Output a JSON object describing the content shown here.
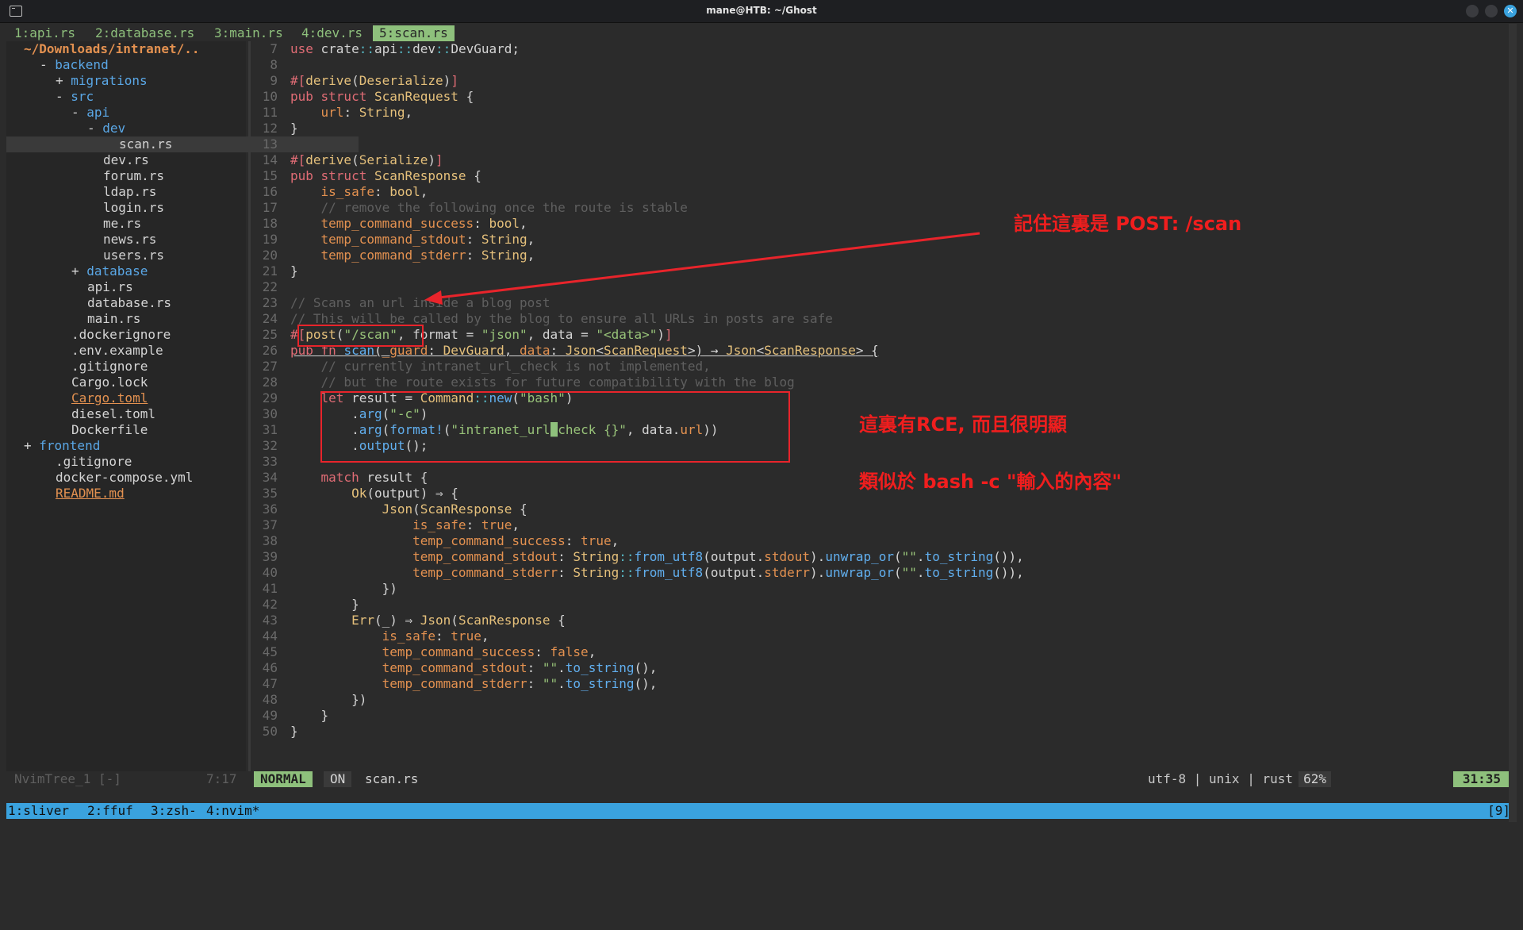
{
  "window": {
    "title": "mane@HTB: ~/Ghost"
  },
  "tabs": [
    "1:api.rs",
    "2:database.rs",
    "3:main.rs",
    "4:dev.rs",
    "5:scan.rs"
  ],
  "tree": {
    "root": "~/Downloads/intranet/..",
    "items": [
      {
        "sign": "- ",
        "name": "backend",
        "indent": 1,
        "kind": "dir"
      },
      {
        "sign": "+ ",
        "name": "migrations",
        "indent": 2,
        "kind": "dir"
      },
      {
        "sign": "- ",
        "name": "src",
        "indent": 2,
        "kind": "dir"
      },
      {
        "sign": "- ",
        "name": "api",
        "indent": 3,
        "kind": "dir"
      },
      {
        "sign": "- ",
        "name": "dev",
        "indent": 4,
        "kind": "dir"
      },
      {
        "sign": "",
        "name": "scan.rs",
        "indent": 6,
        "kind": "file",
        "selected": true
      },
      {
        "sign": "",
        "name": "dev.rs",
        "indent": 5,
        "kind": "file"
      },
      {
        "sign": "",
        "name": "forum.rs",
        "indent": 5,
        "kind": "file"
      },
      {
        "sign": "",
        "name": "ldap.rs",
        "indent": 5,
        "kind": "file"
      },
      {
        "sign": "",
        "name": "login.rs",
        "indent": 5,
        "kind": "file"
      },
      {
        "sign": "",
        "name": "me.rs",
        "indent": 5,
        "kind": "file"
      },
      {
        "sign": "",
        "name": "news.rs",
        "indent": 5,
        "kind": "file"
      },
      {
        "sign": "",
        "name": "users.rs",
        "indent": 5,
        "kind": "file"
      },
      {
        "sign": "+ ",
        "name": "database",
        "indent": 3,
        "kind": "dir"
      },
      {
        "sign": "",
        "name": "api.rs",
        "indent": 4,
        "kind": "file"
      },
      {
        "sign": "",
        "name": "database.rs",
        "indent": 4,
        "kind": "file"
      },
      {
        "sign": "",
        "name": "main.rs",
        "indent": 4,
        "kind": "file"
      },
      {
        "sign": "",
        "name": ".dockerignore",
        "indent": 3,
        "kind": "file"
      },
      {
        "sign": "",
        "name": ".env.example",
        "indent": 3,
        "kind": "file"
      },
      {
        "sign": "",
        "name": ".gitignore",
        "indent": 3,
        "kind": "file"
      },
      {
        "sign": "",
        "name": "Cargo.lock",
        "indent": 3,
        "kind": "file"
      },
      {
        "sign": "",
        "name": "Cargo.toml",
        "indent": 3,
        "kind": "special"
      },
      {
        "sign": "",
        "name": "diesel.toml",
        "indent": 3,
        "kind": "file"
      },
      {
        "sign": "",
        "name": "Dockerfile",
        "indent": 3,
        "kind": "file"
      },
      {
        "sign": "+ ",
        "name": "frontend",
        "indent": 0,
        "kind": "dir"
      },
      {
        "sign": "",
        "name": ".gitignore",
        "indent": 2,
        "kind": "file"
      },
      {
        "sign": "",
        "name": "docker-compose.yml",
        "indent": 2,
        "kind": "file"
      },
      {
        "sign": "",
        "name": "README.md",
        "indent": 2,
        "kind": "special"
      }
    ]
  },
  "editor": {
    "lines": [
      {
        "n": 7,
        "html": "<span class=\"kw\">use</span> crate<span class=\"mc\">::</span>api<span class=\"mc\">::</span>dev<span class=\"mc\">::</span>DevGuard;"
      },
      {
        "n": 8,
        "html": ""
      },
      {
        "n": 9,
        "html": "<span class=\"kw\">#[</span><span class=\"ty\">derive</span>(<span class=\"ty\">Deserialize</span>)<span class=\"kw\">]</span>"
      },
      {
        "n": 10,
        "html": "<span class=\"kw\">pub struct</span> <span class=\"ty\">ScanRequest</span> {"
      },
      {
        "n": 11,
        "html": "    <span class=\"fd\">url</span>: <span class=\"ty\">String</span>,"
      },
      {
        "n": 12,
        "html": "}"
      },
      {
        "n": 13,
        "html": ""
      },
      {
        "n": 14,
        "html": "<span class=\"kw\">#[</span><span class=\"ty\">derive</span>(<span class=\"ty\">Serialize</span>)<span class=\"kw\">]</span>"
      },
      {
        "n": 15,
        "html": "<span class=\"kw\">pub struct</span> <span class=\"ty\">ScanResponse</span> {"
      },
      {
        "n": 16,
        "html": "    <span class=\"fd\">is_safe</span>: <span class=\"ty\">bool</span>,"
      },
      {
        "n": 17,
        "html": "    <span class=\"cm\">// remove the following once the route is stable</span>"
      },
      {
        "n": 18,
        "html": "    <span class=\"fd\">temp_command_success</span>: <span class=\"ty\">bool</span>,"
      },
      {
        "n": 19,
        "html": "    <span class=\"fd\">temp_command_stdout</span>: <span class=\"ty\">String</span>,"
      },
      {
        "n": 20,
        "html": "    <span class=\"fd\">temp_command_stderr</span>: <span class=\"ty\">String</span>,"
      },
      {
        "n": 21,
        "html": "}"
      },
      {
        "n": 22,
        "html": ""
      },
      {
        "n": 23,
        "html": "<span class=\"cm\">// Scans an url inside a blog post</span>"
      },
      {
        "n": 24,
        "html": "<span class=\"cm\">// This will be called by the blog to ensure all URLs in posts are safe</span>"
      },
      {
        "n": 25,
        "html": "<span class=\"kw\">#[</span><span class=\"ty\">post</span>(<span class=\"st\">\"/scan\"</span>, format = <span class=\"st\">\"json\"</span>, data = <span class=\"st\">\"&lt;data&gt;\"</span>)<span class=\"kw\">]</span>"
      },
      {
        "n": 26,
        "html": "<span class=\"ul\"><span class=\"kw\">pub fn</span> <span class=\"fn\">scan</span>(<span class=\"bo\">_guard</span>: <span class=\"ty\">DevGuard</span>, <span class=\"bo\">data</span>: <span class=\"ty\">Json</span>&lt;<span class=\"ty\">ScanRequest</span>&gt;) → <span class=\"ty\">Json</span>&lt;<span class=\"ty\">ScanResponse</span>&gt; {</span>"
      },
      {
        "n": 27,
        "html": "    <span class=\"cm\">// currently intranet_url_check is not implemented,</span>"
      },
      {
        "n": 28,
        "html": "    <span class=\"cm\">// but the route exists for future compatibility with the blog</span>"
      },
      {
        "n": 29,
        "html": "    <span class=\"kw\">let</span> result = <span class=\"ty\">Command</span><span class=\"mc\">::</span><span class=\"fn\">new</span>(<span class=\"st\">\"bash\"</span>)"
      },
      {
        "n": 30,
        "html": "        .<span class=\"fn\">arg</span>(<span class=\"st\">\"-c\"</span>)"
      },
      {
        "n": 31,
        "html": "        .<span class=\"fn\">arg</span>(<span class=\"fn\">format!</span>(<span class=\"st\">\"intranet_url<span class=\"cursor\">_</span>check {}\"</span>, data.<span class=\"fd\">url</span>))"
      },
      {
        "n": 32,
        "html": "        .<span class=\"fn\">output</span>();"
      },
      {
        "n": 33,
        "html": ""
      },
      {
        "n": 34,
        "html": "    <span class=\"kw\">match</span> result {"
      },
      {
        "n": 35,
        "html": "        <span class=\"ty\">Ok</span>(output) ⇒ {"
      },
      {
        "n": 36,
        "html": "            <span class=\"ty\">Json</span>(<span class=\"ty\">ScanResponse</span> {"
      },
      {
        "n": 37,
        "html": "                <span class=\"fd\">is_safe</span>: <span class=\"bo\">true</span>,"
      },
      {
        "n": 38,
        "html": "                <span class=\"fd\">temp_command_success</span>: <span class=\"bo\">true</span>,"
      },
      {
        "n": 39,
        "html": "                <span class=\"fd\">temp_command_stdout</span>: <span class=\"ty\">String</span><span class=\"mc\">::</span><span class=\"fn\">from_utf8</span>(output.<span class=\"fd\">stdout</span>).<span class=\"fn\">unwrap_or</span>(<span class=\"st\">\"\"</span>.<span class=\"fn\">to_string</span>()),"
      },
      {
        "n": 40,
        "html": "                <span class=\"fd\">temp_command_stderr</span>: <span class=\"ty\">String</span><span class=\"mc\">::</span><span class=\"fn\">from_utf8</span>(output.<span class=\"fd\">stderr</span>).<span class=\"fn\">unwrap_or</span>(<span class=\"st\">\"\"</span>.<span class=\"fn\">to_string</span>()),"
      },
      {
        "n": 41,
        "html": "            })"
      },
      {
        "n": 42,
        "html": "        }"
      },
      {
        "n": 43,
        "html": "        <span class=\"ty\">Err</span>(_) ⇒ <span class=\"ty\">Json</span>(<span class=\"ty\">ScanResponse</span> {"
      },
      {
        "n": 44,
        "html": "            <span class=\"fd\">is_safe</span>: <span class=\"bo\">true</span>,"
      },
      {
        "n": 45,
        "html": "            <span class=\"fd\">temp_command_success</span>: <span class=\"bo\">false</span>,"
      },
      {
        "n": 46,
        "html": "            <span class=\"fd\">temp_command_stdout</span>: <span class=\"st\">\"\"</span>.<span class=\"fn\">to_string</span>(),"
      },
      {
        "n": 47,
        "html": "            <span class=\"fd\">temp_command_stderr</span>: <span class=\"st\">\"\"</span>.<span class=\"fn\">to_string</span>(),"
      },
      {
        "n": 48,
        "html": "        })"
      },
      {
        "n": 49,
        "html": "    }"
      },
      {
        "n": 50,
        "html": "}"
      }
    ]
  },
  "statusline": {
    "tree_name": "NvimTree_1 [-]",
    "tree_pos": "7:17",
    "mode": "NORMAL",
    "on": "ON",
    "file": "scan.rs",
    "info": "utf-8 | unix | rust",
    "percent": "62%",
    "position": "31:35"
  },
  "tmux": {
    "windows": [
      "1:sliver",
      "2:ffuf",
      "3:zsh-",
      "4:nvim*"
    ],
    "right": "[9]"
  },
  "annotations": {
    "note1": "記住這裏是 POST: /scan",
    "note2": "這裏有RCE, 而且很明顯",
    "note3": "類似於 bash -c \"輸入的內容\""
  },
  "colors": {
    "accent": "#8ec07c",
    "tmux": "#3aa2de",
    "annotation": "#f01e1e"
  }
}
